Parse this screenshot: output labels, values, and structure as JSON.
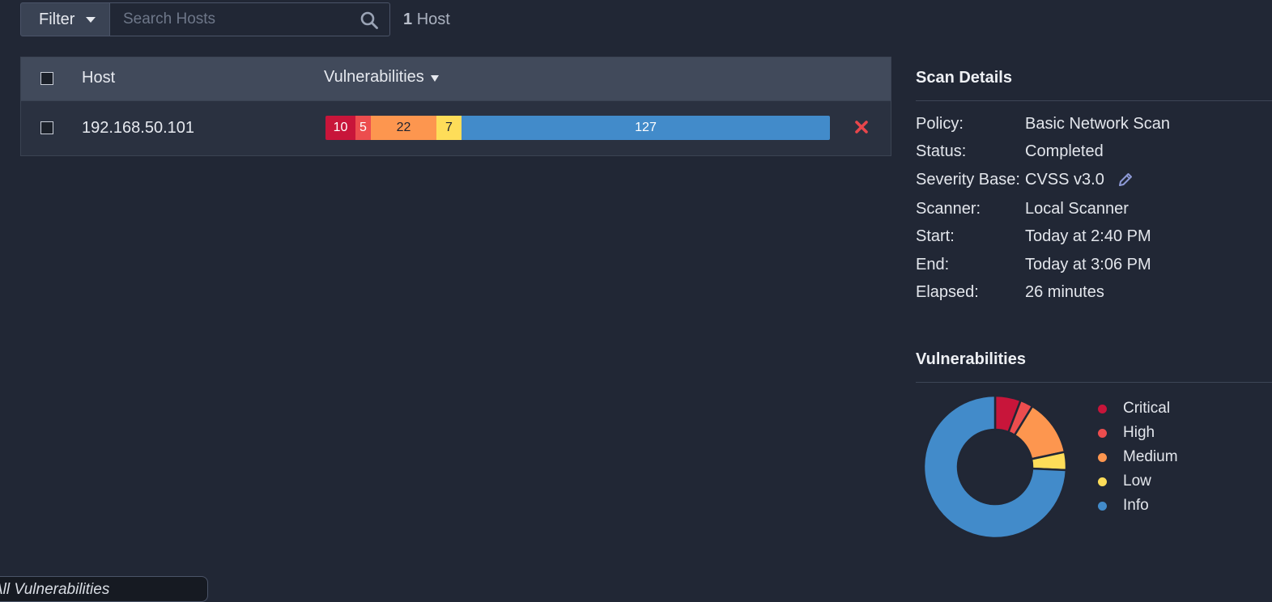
{
  "toolbar": {
    "filter_label": "Filter",
    "search_placeholder": "Search Hosts",
    "host_count": "1",
    "host_count_label": "Host"
  },
  "table": {
    "headers": {
      "host": "Host",
      "vulnerabilities": "Vulnerabilities"
    },
    "rows": [
      {
        "host": "192.168.50.101",
        "counts": {
          "critical": "10",
          "high": "5",
          "medium": "22",
          "low": "7",
          "info": "127"
        }
      }
    ]
  },
  "scan_details": {
    "title": "Scan Details",
    "fields": [
      {
        "label": "Policy:",
        "value": "Basic Network Scan"
      },
      {
        "label": "Status:",
        "value": "Completed"
      },
      {
        "label": "Severity Base:",
        "value": "CVSS v3.0"
      },
      {
        "label": "Scanner:",
        "value": "Local Scanner"
      },
      {
        "label": "Start:",
        "value": "Today at 2:40 PM"
      },
      {
        "label": "End:",
        "value": "Today at 3:06 PM"
      },
      {
        "label": "Elapsed:",
        "value": "26 minutes"
      }
    ]
  },
  "vulnerabilities_panel": {
    "title": "Vulnerabilities",
    "legend": [
      {
        "label": "Critical",
        "color": "#c8153a"
      },
      {
        "label": "High",
        "color": "#ec4d4e"
      },
      {
        "label": "Medium",
        "color": "#fd964f"
      },
      {
        "label": "Low",
        "color": "#fedd59"
      },
      {
        "label": "Info",
        "color": "#428bca"
      }
    ]
  },
  "chart_data": {
    "type": "pie",
    "labels": [
      "Critical",
      "High",
      "Medium",
      "Low",
      "Info"
    ],
    "values": [
      10,
      5,
      22,
      7,
      127
    ],
    "colors": [
      "#c8153a",
      "#ec4d4e",
      "#fd964f",
      "#fedd59",
      "#428bca"
    ],
    "donut": true
  },
  "tooltip": {
    "text": "All Vulnerabilities"
  },
  "icons": {
    "filter_caret": "caret-down-icon",
    "search": "search-icon",
    "sort": "sort-desc-icon",
    "remove": "close-icon",
    "edit": "pencil-icon"
  }
}
